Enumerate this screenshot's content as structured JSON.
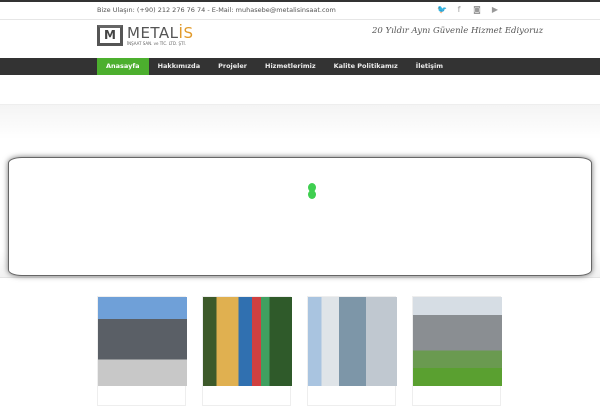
{
  "topbar": {
    "contact": "Bize Ulaşın: (+90) 212 276 76 74 - E-Mail: muhasebe@metalisinsaat.com",
    "social": [
      {
        "icon": "twitter-icon",
        "glyph": "🐦"
      },
      {
        "icon": "facebook-icon",
        "glyph": "f"
      },
      {
        "icon": "instagram-icon",
        "glyph": "◙"
      },
      {
        "icon": "youtube-icon",
        "glyph": "▶"
      }
    ]
  },
  "logo": {
    "mark": "M",
    "name": "METAL",
    "name_accent": "İS",
    "subtitle": "İNŞAAT SAN. ve TİC. LTD. ŞTİ."
  },
  "tagline": "20 Yıldır Aynı Güvenle Hizmet Ediyoruz",
  "nav": [
    "Anasayfa",
    "Hakkımızda",
    "Projeler",
    "Hizmetlerimiz",
    "Kalite Politikamız",
    "İletişim"
  ],
  "colors": {
    "accent": "#4caf2e",
    "nav_bg": "#333333",
    "loader": "#3fcf50"
  }
}
